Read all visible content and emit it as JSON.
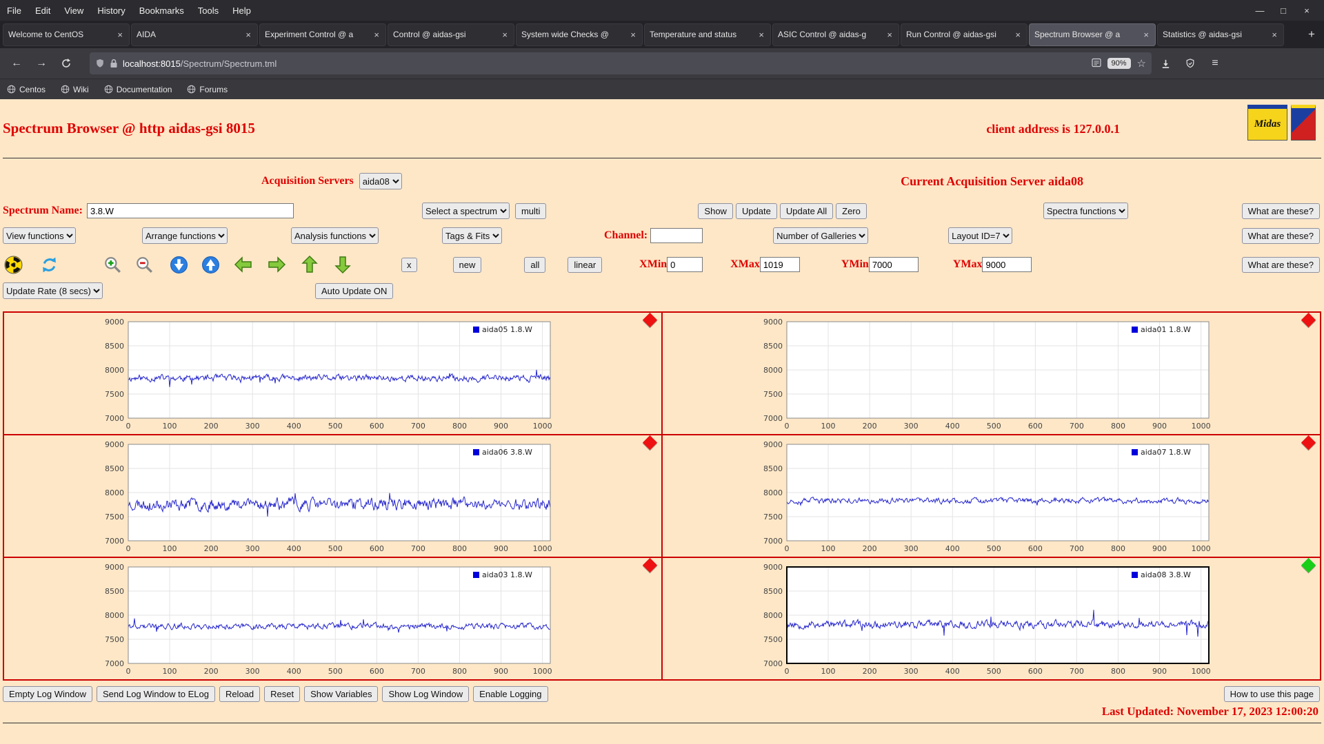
{
  "window": {
    "menu": [
      "File",
      "Edit",
      "View",
      "History",
      "Bookmarks",
      "Tools",
      "Help"
    ]
  },
  "glyphs": {
    "back": "←",
    "forward": "→",
    "menu": "≡",
    "star": "☆",
    "close": "×",
    "new_tab": "+",
    "minimize": "—",
    "maximize": "□",
    "window_close": "×"
  },
  "tabs": {
    "items": [
      {
        "label": "Welcome to CentOS",
        "active": false
      },
      {
        "label": "AIDA",
        "active": false
      },
      {
        "label": "Experiment Control @ a",
        "active": false
      },
      {
        "label": "Control @ aidas-gsi",
        "active": false
      },
      {
        "label": "System wide Checks @",
        "active": false
      },
      {
        "label": "Temperature and status",
        "active": false
      },
      {
        "label": "ASIC Control @ aidas-g",
        "active": false
      },
      {
        "label": "Run Control @ aidas-gsi",
        "active": false
      },
      {
        "label": "Spectrum Browser @ a",
        "active": true
      },
      {
        "label": "Statistics @ aidas-gsi",
        "active": false
      }
    ]
  },
  "navbar": {
    "url_host": "localhost:8015",
    "url_path": "/Spectrum/Spectrum.tml",
    "zoom": "90%"
  },
  "bookmarks": [
    "Centos",
    "Wiki",
    "Documentation",
    "Forums"
  ],
  "header": {
    "title": "Spectrum Browser @ http aidas-gsi 8015",
    "client": "client address is 127.0.0.1",
    "midas_logo": "Midas"
  },
  "acquisition": {
    "label": "Acquisition Servers",
    "server": "aida08",
    "current": "Current Acquisition Server aida08"
  },
  "controls": {
    "spectrum_name_label": "Spectrum Name:",
    "spectrum_name_value": "3.8.W",
    "select_spectrum": "Select a spectrum",
    "multi": "multi",
    "show": "Show",
    "update": "Update",
    "update_all": "Update All",
    "zero": "Zero",
    "spectra_functions": "Spectra functions",
    "what": "What are these?",
    "view_functions": "View functions",
    "arrange_functions": "Arrange functions",
    "analysis_functions": "Analysis functions",
    "tags_fits": "Tags & Fits",
    "channel_label": "Channel:",
    "channel_value": "",
    "number_galleries": "Number of Galleries",
    "layout_id": "Layout ID=7",
    "x": "x",
    "new": "new",
    "all": "all",
    "linear": "linear",
    "xmin_label": "XMin",
    "xmin": "0",
    "xmax_label": "XMax",
    "xmax": "1019",
    "ymin_label": "YMin",
    "ymin": "7000",
    "ymax_label": "YMax",
    "ymax": "9000",
    "update_rate": "Update Rate (8 secs)",
    "auto_update": "Auto Update ON"
  },
  "chart_data": {
    "type": "line",
    "xlim": [
      0,
      1019
    ],
    "ylim": [
      7000,
      9000
    ],
    "xticks": [
      0,
      100,
      200,
      300,
      400,
      500,
      600,
      700,
      800,
      900,
      1000
    ],
    "yticks": [
      7000,
      7500,
      8000,
      8500,
      9000
    ],
    "line_color": "#2525cc",
    "legend_color": "#0000dd",
    "grid": true,
    "legend_position": "top-right",
    "panels": [
      {
        "legend": "aida05 1.8.W",
        "marker": "#ee1111",
        "empty": false,
        "selected": false,
        "seed": 11,
        "baseline": 7830,
        "amp": 48,
        "spike_prob": 0.02,
        "spike_amp": 170
      },
      {
        "legend": "aida01 1.8.W",
        "marker": "#ee1111",
        "empty": true,
        "selected": false,
        "seed": 2,
        "baseline": 7800,
        "amp": 0,
        "spike_prob": 0,
        "spike_amp": 0
      },
      {
        "legend": "aida06 3.8.W",
        "marker": "#ee1111",
        "empty": false,
        "selected": false,
        "seed": 23,
        "baseline": 7760,
        "amp": 85,
        "spike_prob": 0.03,
        "spike_amp": 190
      },
      {
        "legend": "aida07 1.8.W",
        "marker": "#ee1111",
        "empty": false,
        "selected": false,
        "seed": 37,
        "baseline": 7830,
        "amp": 40,
        "spike_prob": 0.01,
        "spike_amp": 130
      },
      {
        "legend": "aida03 1.8.W",
        "marker": "#ee1111",
        "empty": false,
        "selected": false,
        "seed": 41,
        "baseline": 7770,
        "amp": 42,
        "spike_prob": 0.012,
        "spike_amp": 180
      },
      {
        "legend": "aida08 3.8.W",
        "marker": "#19ce19",
        "empty": false,
        "selected": true,
        "seed": 53,
        "baseline": 7810,
        "amp": 55,
        "spike_prob": 0.02,
        "spike_amp": 330
      }
    ]
  },
  "footer": {
    "buttons": [
      "Empty Log Window",
      "Send Log Window to ELog",
      "Reload",
      "Reset",
      "Show Variables",
      "Show Log Window",
      "Enable Logging"
    ],
    "help": "How to use this page",
    "last_updated": "Last Updated: November 17, 2023 12:00:20"
  }
}
